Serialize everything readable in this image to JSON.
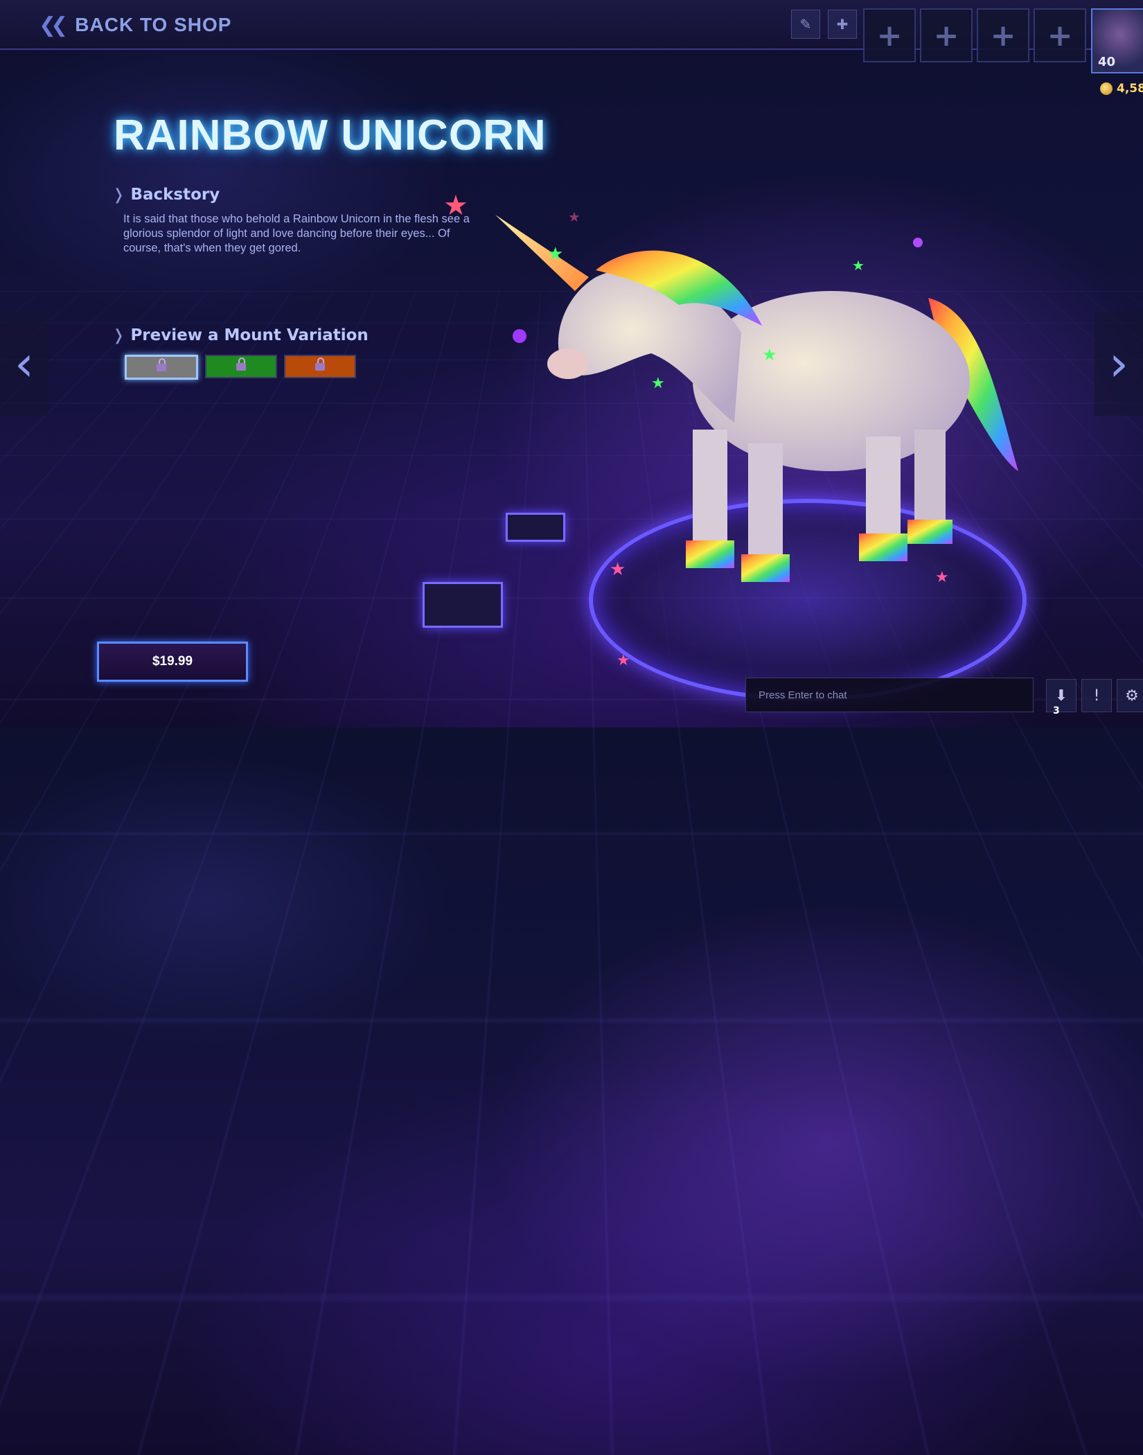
{
  "header": {
    "back_label": "BACK TO SHOP",
    "icons": [
      "pencil-icon",
      "puzzle-icon"
    ],
    "slots": [
      "+",
      "+",
      "+",
      "+"
    ],
    "player_level": "40",
    "currency": "4,58"
  },
  "item": {
    "title": "RAINBOW UNICORN",
    "backstory_heading": "Backstory",
    "backstory_text": "It is said that those who behold a Rainbow Unicorn in the flesh see a glorious splendor of light and love dancing before their eyes... Of course, that's when they get gored.",
    "variation_heading": "Preview a Mount Variation",
    "variations": [
      {
        "color": "#7a7a7a",
        "selected": true
      },
      {
        "color": "#1f8a1f",
        "selected": false
      },
      {
        "color": "#b84a0a",
        "selected": false
      }
    ],
    "price": "$19.99"
  },
  "chat": {
    "placeholder": "Press Enter to chat",
    "badge_count": "3"
  }
}
